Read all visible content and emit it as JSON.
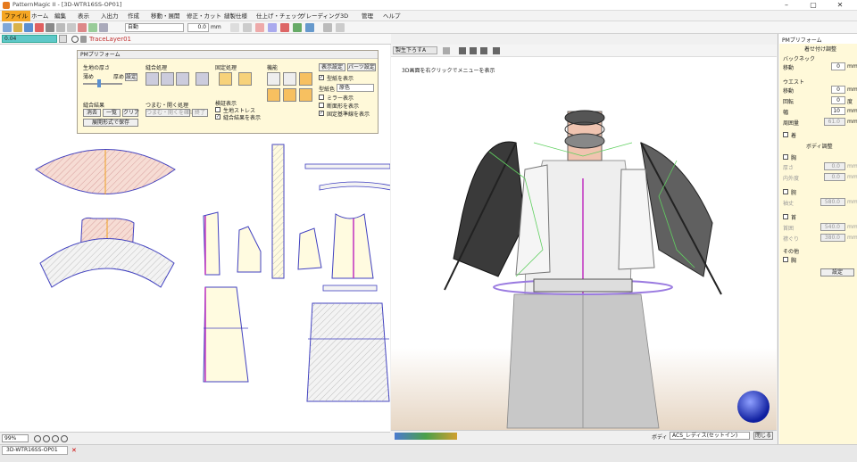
{
  "window": {
    "title": "PatternMagic II - [3D-WTR16SS-OP01]",
    "minimize": "–",
    "maximize": "▢",
    "close": "✕"
  },
  "menu": [
    "ファイル",
    "ホーム",
    "編集",
    "表示",
    "入出力",
    "作成",
    "移動・展開",
    "修正・カット",
    "縫製仕様",
    "仕上げ・チェック",
    "グレーディング",
    "3D",
    "管理",
    "ヘルプ"
  ],
  "toolbar": {
    "layer_field": "自動",
    "size_value": "0.0",
    "unit": "mm"
  },
  "layer": {
    "name_field": "0.04",
    "trace_layer": "TraceLayer01"
  },
  "pm_panel": {
    "title": "PMプリフォーム",
    "thickness": {
      "label": "生地の厚さ",
      "thin": "薄め",
      "thick": "厚め",
      "set_button": "設定"
    },
    "merge": {
      "label": "縫合結果",
      "erase": "消去",
      "all": "一覧",
      "clear": "クリア",
      "save": "展開形式で保存"
    },
    "process": {
      "label": "縫合処理"
    },
    "fold": {
      "label": "つまむ・開く処理",
      "input": "つまむ・開くを確認",
      "end": "終了"
    },
    "fixed": {
      "label": "固定処理"
    },
    "check_display": {
      "label": "検証表示",
      "stretch": "生地ストレス",
      "result": "縫合結果を表示"
    },
    "features": {
      "label": "機能"
    },
    "display_settings": "表示設定",
    "parts_settings": "パーツ設定",
    "show_pattern": "型紙を表示",
    "pattern_color_label": "型紙色",
    "pattern_color": "原色",
    "mirror": "ミラー表示",
    "cross_section": "断面形を表示",
    "fixed_ref": "固定基準線を表示"
  },
  "view3d": {
    "tab_label": "製生下ろすA",
    "hint": "3D画面を右クリックでメニューを表示"
  },
  "bottom3d": {
    "body_label": "ボディ",
    "body_value": "ACS_レディス(セットイン)",
    "close": "閉じる"
  },
  "right_panel": {
    "title": "PMプリフォーム",
    "section_fit": "着せ付け調整",
    "back_neck": {
      "label": "バックネック",
      "move_label": "移動",
      "move": "0",
      "unit": "mm"
    },
    "waist": {
      "label": "ウエスト",
      "move_label": "移動",
      "move": "0",
      "rotate_label": "回転",
      "rotate": "0",
      "rot_unit": "度",
      "width_label": "幅",
      "width": "10",
      "circ_label": "周囲量",
      "circ": "61.0"
    },
    "chk_plate": "着",
    "section_body": "ボディ調整",
    "chest": {
      "label": "胸",
      "thick_label": "厚さ",
      "thick": "0.0",
      "out_label": "内外度",
      "out": "0.0"
    },
    "arm": {
      "label": "腕",
      "len_label": "袖丈",
      "len": "580.0"
    },
    "neck": {
      "label": "首",
      "base_label": "首囲",
      "base": "540.0",
      "circ_label": "襟ぐり",
      "circ": "380.0"
    },
    "other": {
      "label": "その他",
      "chk": "胸"
    },
    "set_button": "設定"
  },
  "status": {
    "zoom": "99%"
  },
  "tabs": {
    "active": "3D-WTR16SS-OP01"
  },
  "colors": {
    "accent": "#f5a623",
    "panel": "#fff9d9",
    "pattern_blue": "#4040c0",
    "pattern_fill": "#f3d2c8",
    "grain_yellow": "#f0d060",
    "sleeve_gray": "#3a3a3a"
  }
}
